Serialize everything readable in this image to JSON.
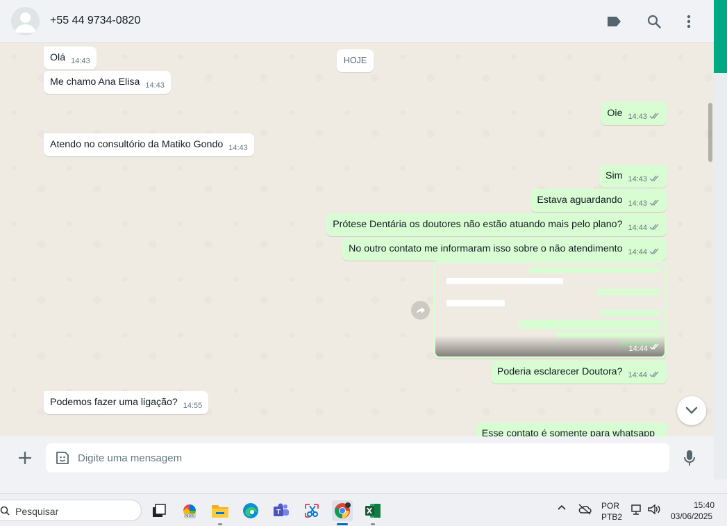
{
  "header": {
    "contact_name": "+55 44 9734-0820",
    "icons": [
      "label-icon",
      "search-icon",
      "menu-dots-icon"
    ]
  },
  "chat": {
    "day_badge": "HOJE",
    "messages": [
      {
        "direction": "in",
        "text": "Olá",
        "time": "14:43"
      },
      {
        "direction": "in",
        "text": "Me chamo Ana Elisa",
        "time": "14:43"
      },
      {
        "direction": "out",
        "text": "Oie",
        "time": "14:43",
        "status": "read"
      },
      {
        "direction": "in",
        "text": "Atendo no consultório da Matiko Gondo",
        "time": "14:43"
      },
      {
        "direction": "out",
        "text": "Sim",
        "time": "14:43",
        "status": "read"
      },
      {
        "direction": "out",
        "text": "Estava aguardando",
        "time": "14:43",
        "status": "read"
      },
      {
        "direction": "out",
        "text": "Prótese Dentária os doutores não estão atuando mais pelo plano?",
        "time": "14:44",
        "status": "read"
      },
      {
        "direction": "out",
        "text": "No outro contato me informaram isso sobre o não atendimento",
        "time": "14:44",
        "status": "read"
      },
      {
        "direction": "out",
        "text": "",
        "time": "14:44",
        "status": "read",
        "type": "image"
      },
      {
        "direction": "out",
        "text": "Poderia esclarecer Doutora?",
        "time": "14:44",
        "status": "read"
      },
      {
        "direction": "in",
        "text": "Podemos fazer uma ligação?",
        "time": "14:55"
      },
      {
        "direction": "out",
        "text": "Esse contato é somente para whatsapp",
        "time": "",
        "status": "read"
      }
    ]
  },
  "composer": {
    "placeholder": "Digite uma mensagem"
  },
  "taskbar": {
    "search_label": "Pesquisar",
    "apps": [
      "task-view-icon",
      "m365-icon",
      "file-explorer-icon",
      "edge-icon",
      "teams-icon",
      "snipping-tool-icon",
      "chrome-icon",
      "excel-icon"
    ],
    "lang_line1": "POR",
    "lang_line2": "PTB2",
    "time": "15:40",
    "date": "03/06/2025"
  },
  "colors": {
    "accent": "#00a884",
    "outgoing_bubble": "#d9fdd3",
    "incoming_bubble": "#ffffff",
    "read_ticks": "#53bdeb"
  }
}
